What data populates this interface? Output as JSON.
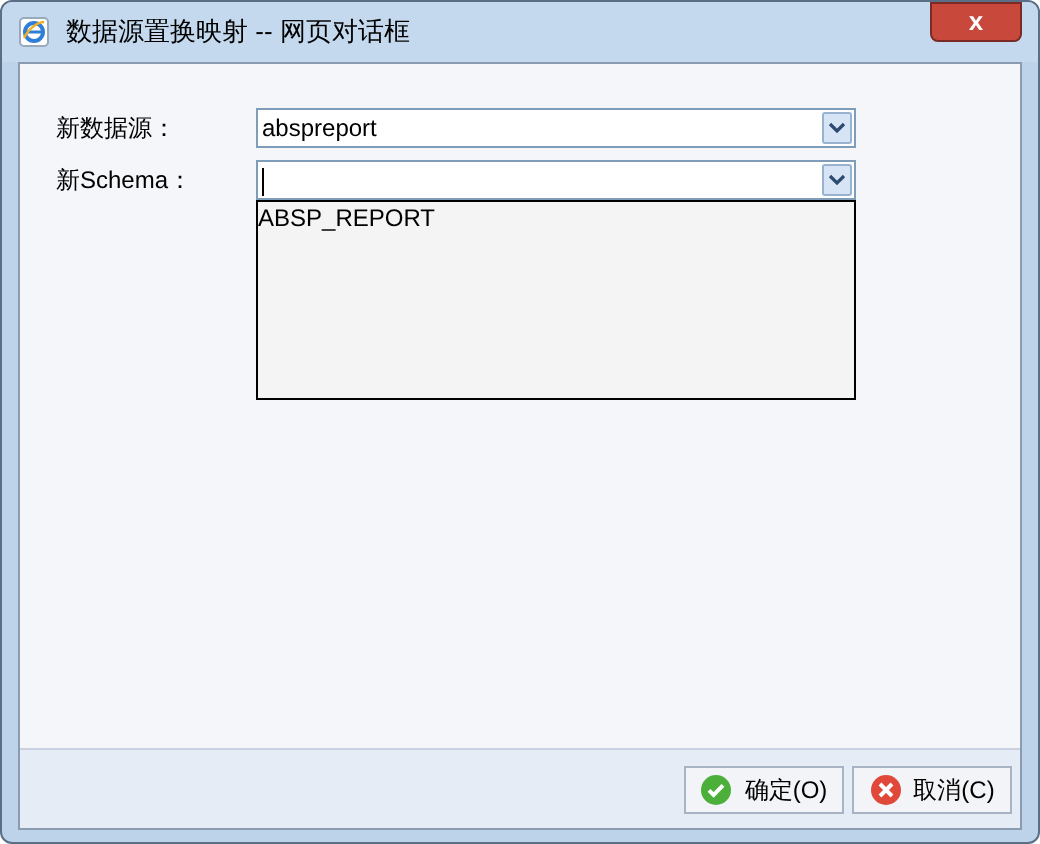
{
  "window": {
    "title": "数据源置换映射 -- 网页对话框",
    "close": "x"
  },
  "fields": [
    {
      "label": "新数据源：",
      "value": "abspreport",
      "open": false
    },
    {
      "label": "新Schema：",
      "open": true,
      "options": [
        "ABSP_REPORT"
      ]
    }
  ],
  "buttons": [
    {
      "label": "确定(O)",
      "kind": "ok"
    },
    {
      "label": "取消(C)",
      "kind": "cancel"
    }
  ]
}
